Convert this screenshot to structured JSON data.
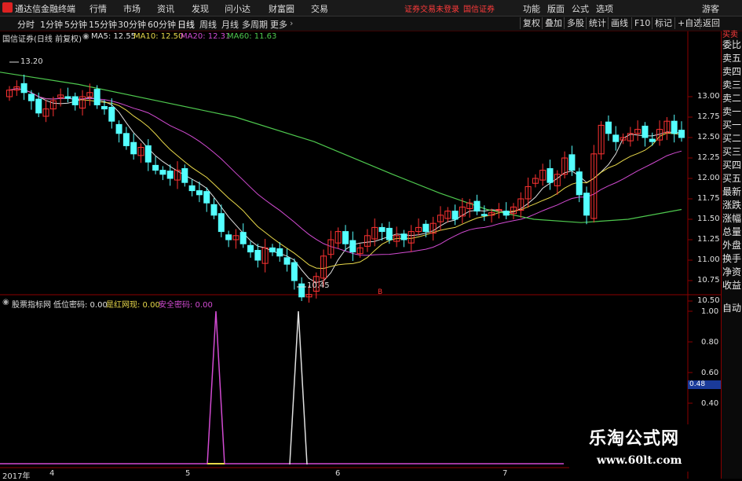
{
  "app": {
    "title": "通达信金融终端"
  },
  "menu": [
    "行情",
    "市场",
    "资讯",
    "发现",
    "问小达",
    "财富圈",
    "交易"
  ],
  "status": {
    "trade_status": "证券交易未登录",
    "broker": "国信证券"
  },
  "top_right": {
    "function": "功能",
    "layout": "版面",
    "formula": "公式",
    "options": "选项",
    "guest": "游客"
  },
  "periods": [
    "分时",
    "1分钟",
    "5分钟",
    "15分钟",
    "30分钟",
    "60分钟",
    "日线",
    "周线",
    "月线",
    "多周期",
    "更多"
  ],
  "active_period": "日线",
  "toolbar_right": [
    "复权",
    "叠加",
    "多股",
    "统计",
    "画线",
    "F10",
    "标记",
    "+自选",
    "返回"
  ],
  "chart": {
    "title": "国信证券(日线 前复权)",
    "ma": [
      {
        "label": "MA5: 12.55",
        "color": "#e0e0e0"
      },
      {
        "label": "MA10: 12.50",
        "color": "#e8d84a"
      },
      {
        "label": "MA20: 12.31",
        "color": "#d24bd2"
      },
      {
        "label": "MA60: 11.63",
        "color": "#4ec84e"
      }
    ],
    "high_label": "13.20",
    "low_label": "10.45",
    "marker": "B",
    "ticks": [
      "13.00",
      "12.75",
      "12.50",
      "12.25",
      "12.00",
      "11.75",
      "11.50",
      "11.25",
      "11.00",
      "10.75",
      "10.50"
    ]
  },
  "indicator": {
    "name": "股票指标网",
    "fields": [
      {
        "label": "低位密码: 0.00",
        "color": "#e0e0e0"
      },
      {
        "label": "是红网现: 0.00",
        "color": "#e8d84a"
      },
      {
        "label": "安全密码: 0.00",
        "color": "#d24bd2"
      }
    ],
    "ticks": [
      "1.00",
      "0.80",
      "0.60",
      "0.48",
      "0.40"
    ],
    "current_value": "0.48"
  },
  "xaxis": [
    "2017年",
    "4",
    "5",
    "6",
    "7"
  ],
  "side": {
    "top": "买卖",
    "labels": [
      "委比",
      "卖五",
      "卖四",
      "卖三",
      "卖二",
      "卖一",
      "买一",
      "买二",
      "买三",
      "买四",
      "买五",
      "最新",
      "涨跌",
      "涨幅",
      "总量",
      "外盘",
      "换手",
      "净资",
      "收益"
    ],
    "auto": "自动"
  },
  "watermark": {
    "name": "乐淘公式网",
    "url": "www.60lt.com"
  },
  "colors": {
    "up": "#ff3232",
    "down": "#54ffff",
    "frame": "#8b0000"
  }
}
